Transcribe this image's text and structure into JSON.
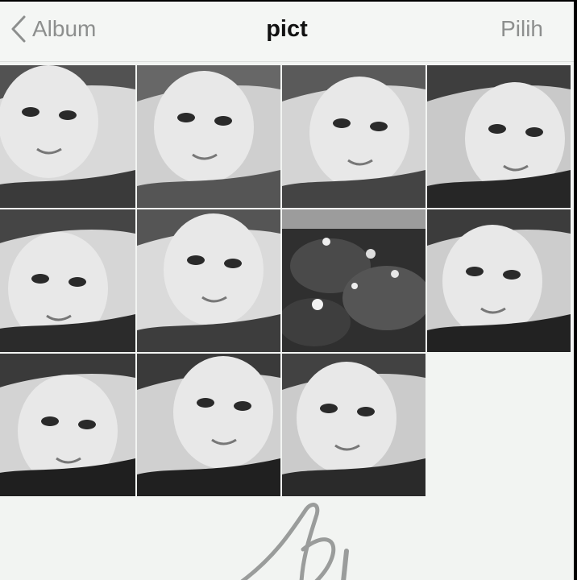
{
  "navbar": {
    "back_label": "Album",
    "title": "pict",
    "action_label": "Pilih"
  },
  "grid": {
    "photos": [
      {
        "kind": "selfie",
        "tone": "#d9d9d9",
        "dark": "#3a3a3a"
      },
      {
        "kind": "selfie",
        "tone": "#cfcfcf",
        "dark": "#555555"
      },
      {
        "kind": "selfie",
        "tone": "#d4d4d4",
        "dark": "#444444"
      },
      {
        "kind": "selfie",
        "tone": "#c9c9c9",
        "dark": "#262626"
      },
      {
        "kind": "selfie",
        "tone": "#d6d6d6",
        "dark": "#2b2b2b"
      },
      {
        "kind": "selfie",
        "tone": "#dadada",
        "dark": "#3d3d3d"
      },
      {
        "kind": "flowers",
        "tone": "#7a7a7a",
        "dark": "#2f2f2f"
      },
      {
        "kind": "selfie",
        "tone": "#cdcdcd",
        "dark": "#222222"
      },
      {
        "kind": "selfie",
        "tone": "#d3d3d3",
        "dark": "#1f1f1f"
      },
      {
        "kind": "selfie",
        "tone": "#d0d0d0",
        "dark": "#202020"
      },
      {
        "kind": "selfie",
        "tone": "#cbcbcb",
        "dark": "#2a2a2a"
      }
    ]
  },
  "colors": {
    "background": "#f2f4f2",
    "secondary_text": "#8d8f8e",
    "title_text": "#111111"
  }
}
